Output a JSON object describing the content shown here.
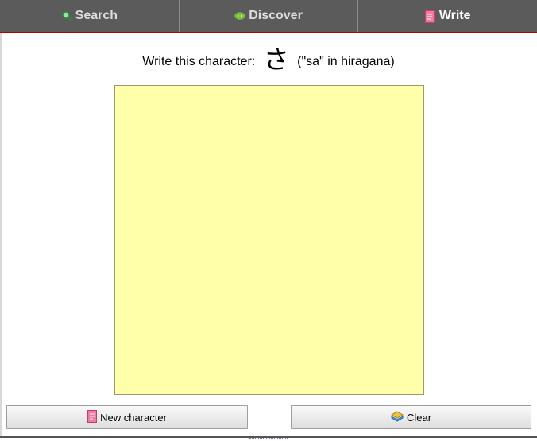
{
  "tabs": [
    {
      "label": "Search",
      "icon": "search-icon"
    },
    {
      "label": "Discover",
      "icon": "chat-bubble-icon"
    },
    {
      "label": "Write",
      "icon": "notepad-icon",
      "active": true
    }
  ],
  "prompt": {
    "lead": "Write this character:",
    "character": "さ",
    "reading": "(\"sa\" in hiragana)"
  },
  "buttons": {
    "new_character": "New character",
    "clear": "Clear"
  },
  "colors": {
    "tabbar": "#5b5b5b",
    "active_underline": "#b40000",
    "canvas": "#ffffa9"
  }
}
